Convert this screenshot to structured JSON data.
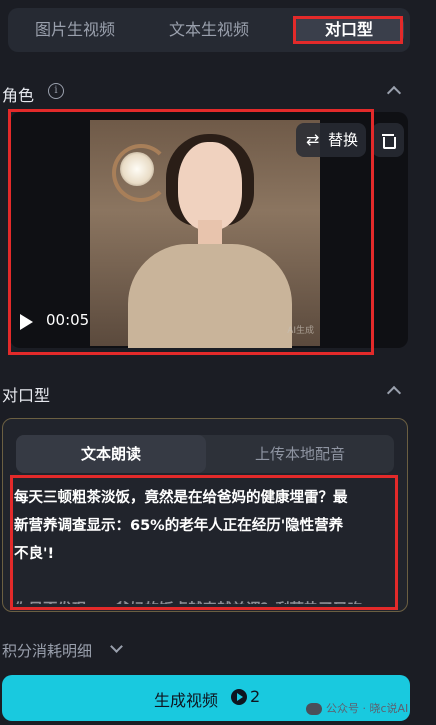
{
  "tabs": [
    {
      "label": "图片生视频"
    },
    {
      "label": "文本生视频"
    },
    {
      "label": "对口型",
      "active": true
    }
  ],
  "role_section": {
    "title": "角色",
    "info_icon": "info-icon",
    "video": {
      "time": "00:05",
      "replace_label": "替换",
      "replace_icon": "swap-icon",
      "delete_icon": "trash-icon",
      "watermark": "AI生成"
    }
  },
  "lip_section": {
    "title": "对口型",
    "sub_tabs": [
      "文本朗读",
      "上传本地配音"
    ],
    "text_lines": [
      "每天三顿粗茶淡饭，竟然是在给爸妈的健康埋雷？最",
      "新营养调查显示：65%的老年人正在经历'隐性营养",
      "不良'!",
      "",
      "你是否发现……爸妈的饭桌越来越单调？剩菜热了又吃"
    ]
  },
  "points_detail": "积分消耗明细",
  "generate": {
    "label": "生成视频",
    "count": "2"
  },
  "footer_watermark": "公众号 · 晓c说AI",
  "colors": {
    "accent": "#19c9df",
    "highlight_border": "#e32a2a",
    "background": "#1b1d24"
  }
}
